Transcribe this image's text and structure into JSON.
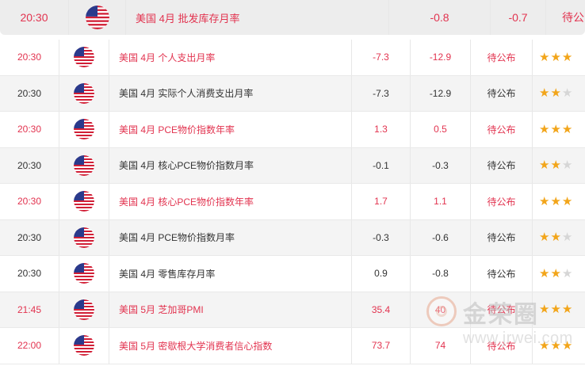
{
  "colors": {
    "highlight": "#e2334f",
    "normal": "#333333",
    "star": "#f2a51a",
    "star_off": "#d6d6d6"
  },
  "top_row": {
    "time": "20:30",
    "flag_icon": "us-flag-icon",
    "event": "美国 4月 批发库存月率",
    "prior": "-0.8",
    "forecast": "-0.7",
    "actual": "待公"
  },
  "rows": [
    {
      "time": "20:30",
      "flag_icon": "us-flag-icon",
      "event": "美国 4月 个人支出月率",
      "prior": "-7.3",
      "forecast": "-12.9",
      "actual": "待公布",
      "importance": 3,
      "highlight": true
    },
    {
      "time": "20:30",
      "flag_icon": "us-flag-icon",
      "event": "美国 4月 实际个人消费支出月率",
      "prior": "-7.3",
      "forecast": "-12.9",
      "actual": "待公布",
      "importance": 2,
      "highlight": false
    },
    {
      "time": "20:30",
      "flag_icon": "us-flag-icon",
      "event": "美国 4月 PCE物价指数年率",
      "prior": "1.3",
      "forecast": "0.5",
      "actual": "待公布",
      "importance": 3,
      "highlight": true
    },
    {
      "time": "20:30",
      "flag_icon": "us-flag-icon",
      "event": "美国 4月 核心PCE物价指数月率",
      "prior": "-0.1",
      "forecast": "-0.3",
      "actual": "待公布",
      "importance": 2,
      "highlight": false
    },
    {
      "time": "20:30",
      "flag_icon": "us-flag-icon",
      "event": "美国 4月 核心PCE物价指数年率",
      "prior": "1.7",
      "forecast": "1.1",
      "actual": "待公布",
      "importance": 3,
      "highlight": true
    },
    {
      "time": "20:30",
      "flag_icon": "us-flag-icon",
      "event": "美国 4月 PCE物价指数月率",
      "prior": "-0.3",
      "forecast": "-0.6",
      "actual": "待公布",
      "importance": 2,
      "highlight": false
    },
    {
      "time": "20:30",
      "flag_icon": "us-flag-icon",
      "event": "美国 4月 零售库存月率",
      "prior": "0.9",
      "forecast": "-0.8",
      "actual": "待公布",
      "importance": 2,
      "highlight": false
    },
    {
      "time": "21:45",
      "flag_icon": "us-flag-icon",
      "event": "美国 5月 芝加哥PMI",
      "prior": "35.4",
      "forecast": "40",
      "actual": "待公布",
      "importance": 3,
      "highlight": true
    },
    {
      "time": "22:00",
      "flag_icon": "us-flag-icon",
      "event": "美国 5月 密歇根大学消费者信心指数",
      "prior": "73.7",
      "forecast": "74",
      "actual": "待公布",
      "importance": 3,
      "highlight": true
    }
  ],
  "watermark": {
    "brand": "金荣圈",
    "url": "www.jrwei.com"
  }
}
